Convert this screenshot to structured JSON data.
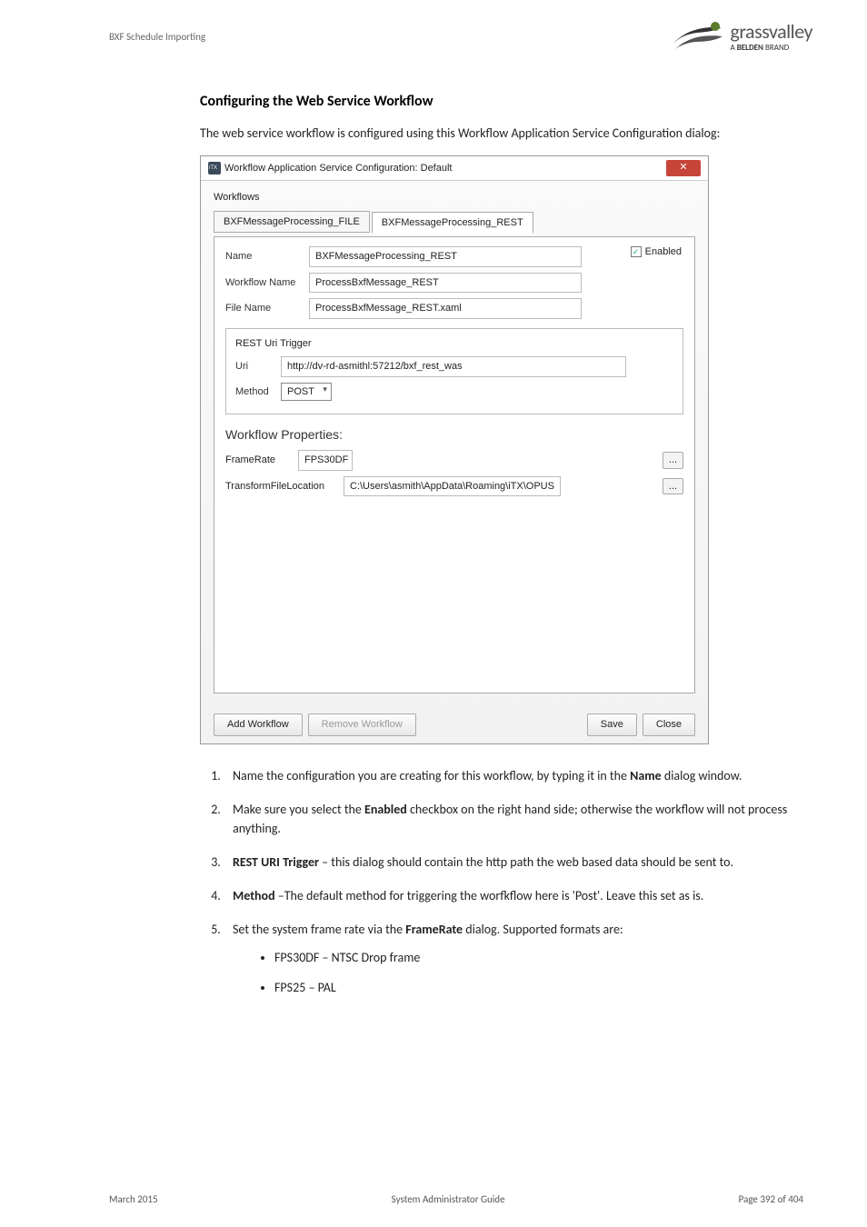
{
  "header": {
    "section": "BXF Schedule Importing"
  },
  "logo": {
    "main": "grassvalley",
    "sub_prefix": "A ",
    "sub_bold": "BELDEN",
    "sub_suffix": " BRAND"
  },
  "heading": "Configuring the Web Service Workflow",
  "intro": "The web service workflow is configured using this Workflow Application Service Configuration dialog:",
  "dialog": {
    "title": "Workflow Application Service Configuration: Default",
    "workflows_label": "Workflows",
    "tabs": [
      "BXFMessageProcessing_FILE",
      "BXFMessageProcessing_REST"
    ],
    "name_label": "Name",
    "name_value": "BXFMessageProcessing_REST",
    "workflow_name_label": "Workflow Name",
    "workflow_name_value": "ProcessBxfMessage_REST",
    "file_name_label": "File Name",
    "file_name_value": "ProcessBxfMessage_REST.xaml",
    "enabled_label": "Enabled",
    "rest_group": "REST Uri Trigger",
    "uri_label": "Uri",
    "uri_value": "http://dv-rd-asmithl:57212/bxf_rest_was",
    "method_label": "Method",
    "method_value": "POST",
    "props_title": "Workflow Properties:",
    "framerate_label": "FrameRate",
    "framerate_value": "FPS30DF",
    "transform_label": "TransformFileLocation",
    "transform_value": "C:\\Users\\asmith\\AppData\\Roaming\\iTX\\OPUS",
    "dots": "...",
    "btn_add": "Add Workflow",
    "btn_remove": "Remove Workflow",
    "btn_save": "Save",
    "btn_close": "Close"
  },
  "steps": {
    "s1a": "Name the configuration you are creating for this workflow, by typing it in the ",
    "s1b": "Name",
    "s1c": " dialog window.",
    "s2a": "Make sure you select the ",
    "s2b": "Enabled",
    "s2c": " checkbox on the right hand side; otherwise the workflow will not process anything.",
    "s3a": "REST URI Trigger",
    "s3b": " – this dialog should contain the http path the web based data should be sent to.",
    "s4a": "Method",
    "s4b": " –The default method for triggering the worfkflow here is 'Post'. Leave this set as is.",
    "s5a": "Set the system frame rate via the ",
    "s5b": "FrameRate",
    "s5c": " dialog. Supported formats are:",
    "sub1": "FPS30DF – NTSC Drop frame",
    "sub2": "FPS25 – PAL"
  },
  "footer": {
    "left": "March 2015",
    "center": "System Administrator Guide",
    "right": "Page 392 of 404"
  }
}
